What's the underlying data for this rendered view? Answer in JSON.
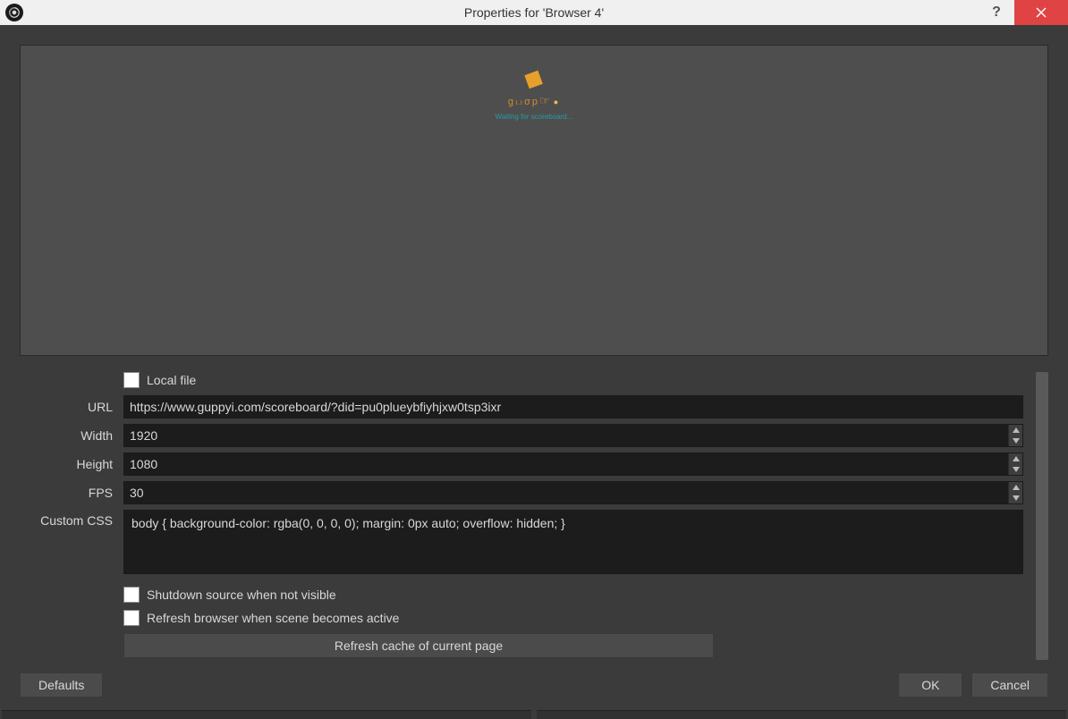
{
  "titlebar": {
    "title": "Properties for 'Browser 4'"
  },
  "preview": {
    "brand": "gபσp",
    "tagline": "Waiting for scoreboard..."
  },
  "form": {
    "local_file": {
      "label": "Local file",
      "checked": false
    },
    "url": {
      "label": "URL",
      "value": "https://www.guppyi.com/scoreboard/?did=pu0plueybfiyhjxw0tsp3ixr"
    },
    "width": {
      "label": "Width",
      "value": "1920"
    },
    "height": {
      "label": "Height",
      "value": "1080"
    },
    "fps": {
      "label": "FPS",
      "value": "30"
    },
    "custom_css": {
      "label": "Custom CSS",
      "value": "body { background-color: rgba(0, 0, 0, 0); margin: 0px auto; overflow: hidden; }"
    },
    "shutdown": {
      "label": "Shutdown source when not visible",
      "checked": false
    },
    "refresh_active": {
      "label": "Refresh browser when scene becomes active",
      "checked": false
    },
    "refresh_cache_btn": "Refresh cache of current page"
  },
  "footer": {
    "defaults": "Defaults",
    "ok": "OK",
    "cancel": "Cancel"
  }
}
